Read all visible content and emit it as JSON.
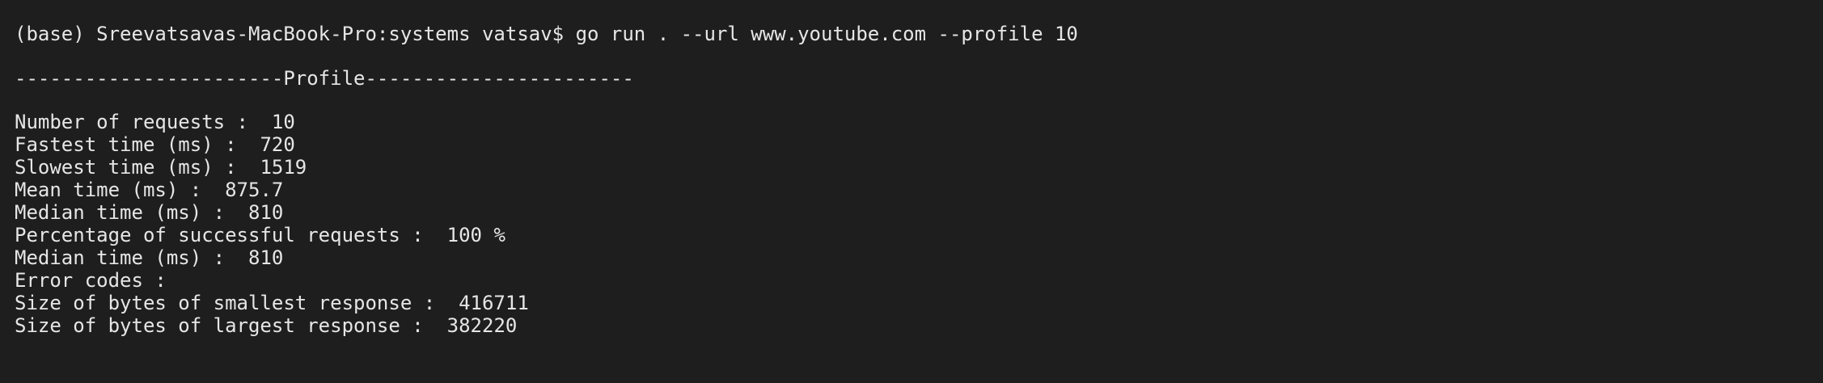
{
  "terminal": {
    "command_line": "(base) Sreevatsavas-MacBook-Pro:systems vatsav$ go run . --url www.youtube.com --profile 10",
    "profile_header": "-----------------------Profile-----------------------",
    "stats": [
      {
        "label": "Number of requests :",
        "value": "10"
      },
      {
        "label": "Fastest time (ms) :",
        "value": "720"
      },
      {
        "label": "Slowest time (ms) :",
        "value": "1519"
      },
      {
        "label": "Mean time (ms) :",
        "value": "875.7"
      },
      {
        "label": "Median time (ms) :",
        "value": "810"
      },
      {
        "label": "Percentage of successful requests :",
        "value": "100 %"
      },
      {
        "label": "Median time (ms) :",
        "value": "810"
      },
      {
        "label": "Error codes :",
        "value": ""
      },
      {
        "label": "Size of bytes of smallest response :",
        "value": "416711"
      },
      {
        "label": "Size of bytes of largest response :",
        "value": "382220"
      }
    ]
  }
}
